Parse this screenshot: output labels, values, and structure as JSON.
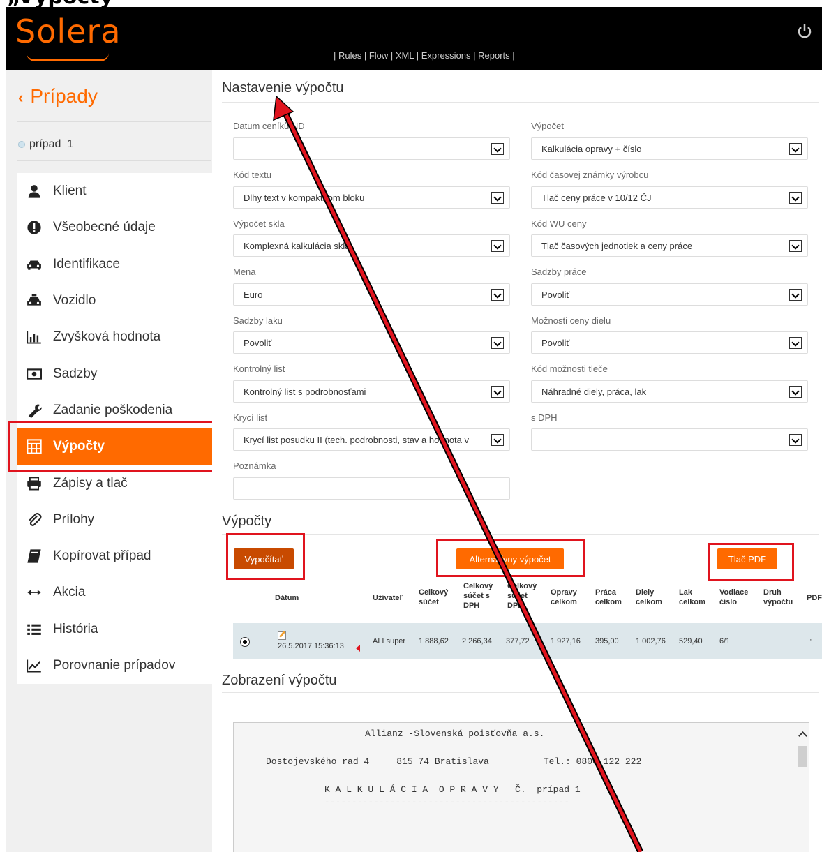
{
  "top_heading": "„Výpočty",
  "header": {
    "logo": "Solera",
    "nav": "| Rules | Flow | XML | Expressions | Reports |",
    "power_icon": "power-icon"
  },
  "sidebar": {
    "back_label": "Prípady",
    "case_name": "prípad_1",
    "items": [
      {
        "label": "Klient",
        "icon": "user-icon"
      },
      {
        "label": "Všeobecné údaje",
        "icon": "info-icon"
      },
      {
        "label": "Identifikace",
        "icon": "car-icon"
      },
      {
        "label": "Vozidlo",
        "icon": "taxi-icon"
      },
      {
        "label": "Zvyšková hodnota",
        "icon": "bar-chart-icon"
      },
      {
        "label": "Sadzby",
        "icon": "money-icon"
      },
      {
        "label": "Zadanie poškodenia",
        "icon": "wrench-icon"
      },
      {
        "label": "Výpočty",
        "icon": "calculator-icon"
      },
      {
        "label": "Zápisy a tlač",
        "icon": "printer-icon"
      },
      {
        "label": "Prílohy",
        "icon": "paperclip-icon"
      },
      {
        "label": "Kopírovat případ",
        "icon": "book-icon"
      },
      {
        "label": "Akcia",
        "icon": "arrows-horizontal-icon"
      },
      {
        "label": "História",
        "icon": "list-icon"
      },
      {
        "label": "Porovnanie prípadov",
        "icon": "line-chart-icon"
      }
    ],
    "active_index": 7
  },
  "settings": {
    "title": "Nastavenie výpočtu",
    "left": [
      {
        "label": "Datum ceníků ND",
        "value": ""
      },
      {
        "label": "Kód textu",
        "value": "Dlhy text v kompaktnom bloku"
      },
      {
        "label": "Výpočet skla",
        "value": "Komplexná kalkulácia skla"
      },
      {
        "label": "Mena",
        "value": "Euro"
      },
      {
        "label": "Sadzby laku",
        "value": "Povoliť"
      },
      {
        "label": "Kontrolný list",
        "value": "Kontrolný list s podrobnosťami"
      },
      {
        "label": "Krycí list",
        "value": "Krycí list posudku II (tech. podrobnosti, stav a hodnota v"
      },
      {
        "label": "Poznámka",
        "value": ""
      }
    ],
    "right": [
      {
        "label": "Výpočet",
        "value": "Kalkulácia opravy + číslo"
      },
      {
        "label": "Kód časovej známky výrobcu",
        "value": "Tlač ceny práce v 10/12 ČJ"
      },
      {
        "label": "Kód WU ceny",
        "value": "Tlač časových jednotiek a ceny práce"
      },
      {
        "label": "Sadzby práce",
        "value": "Povoliť"
      },
      {
        "label": "Možnosti ceny dielu",
        "value": "Povoliť"
      },
      {
        "label": "Kód možnosti tleče",
        "value": "Náhradné diely, práca, lak"
      },
      {
        "label": "s DPH",
        "value": ""
      }
    ]
  },
  "calculations": {
    "title": "Výpočty",
    "buttons": {
      "calculate": "Vypočítať",
      "alternative": "Alternatívny výpočet",
      "print_pdf": "Tlač PDF"
    },
    "columns": [
      "Dátum",
      "Užívateľ",
      "Celkový súčet",
      "Celkový súčet s DPH",
      "Celkový súčet DPH",
      "Opravy celkom",
      "Práca celkom",
      "Diely celkom",
      "Lak celkom",
      "Vodiace číslo",
      "Druh výpočtu",
      "PDF"
    ],
    "rows": [
      {
        "date": "26.5.2017 15:36:13",
        "user": "ALLsuper",
        "total": "1 888,62",
        "total_vat": "2 266,34",
        "vat": "377,72",
        "repairs": "1 927,16",
        "labour": "395,00",
        "parts": "1 002,76",
        "paint": "529,40",
        "guide_no": "6/1",
        "type": "",
        "pdf": "·"
      }
    ]
  },
  "preview": {
    "title": "Zobrazení výpočtu",
    "lines": [
      "Allianz -Slovenská poisťovňa a.s.",
      "Dostojevského rad 4     815 74 Bratislava          Tel.: 0800 122 222",
      "K A L K U L Á C I A  O P R A V Y   Č.  prípad_1",
      "---------------------------------------------"
    ]
  },
  "colors": {
    "accent": "#ff6a00",
    "highlight": "#e0141e",
    "header_bg": "#000000",
    "row_bg": "#dde7eb"
  }
}
